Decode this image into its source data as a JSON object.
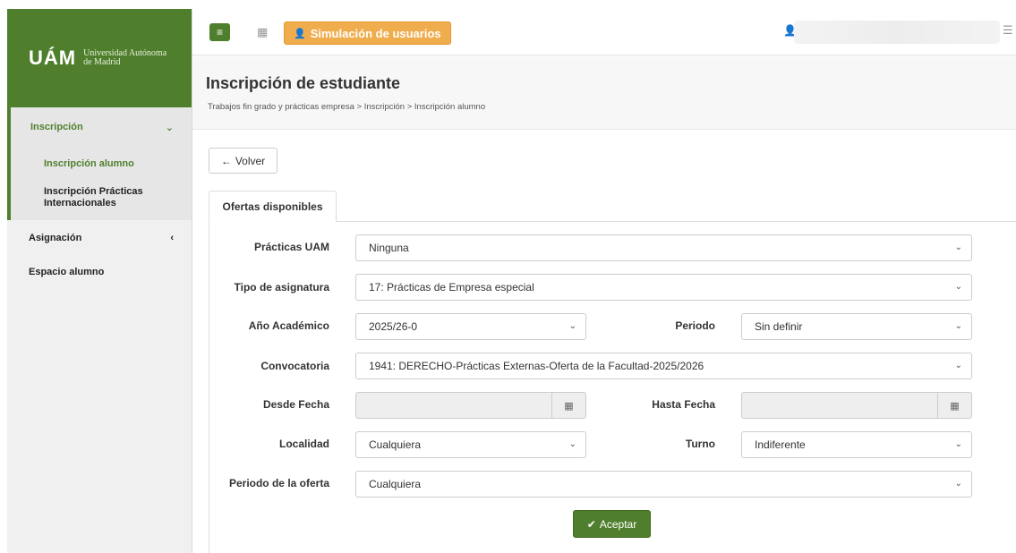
{
  "sidebar": {
    "logo_mark": "UÁM",
    "logo_line1": "Universidad Autónoma",
    "logo_line2": "de Madrid",
    "items": [
      {
        "label": "Inscripción",
        "chevron": "⌄"
      },
      {
        "label": "Inscripción alumno"
      },
      {
        "label": "Inscripción Prácticas Internacionales"
      },
      {
        "label": "Asignación",
        "chevron": "‹"
      },
      {
        "label": "Espacio alumno"
      }
    ]
  },
  "topbar": {
    "menu_icon": "≡",
    "grid_icon": "▦",
    "sim_icon": "👤",
    "sim_label": "Simulación de usuarios",
    "user_icon": "👤",
    "right_icon": "☰"
  },
  "header": {
    "title": "Inscripción de estudiante",
    "breadcrumb": "Trabajos fin grado y prácticas empresa > Inscripción > Inscripción alumno"
  },
  "back_button": {
    "icon": "←",
    "label": "Volver"
  },
  "tab": {
    "label": "Ofertas disponibles"
  },
  "form": {
    "practicas_uam": {
      "label": "Prácticas UAM",
      "value": "Ninguna"
    },
    "tipo_asignatura": {
      "label": "Tipo de asignatura",
      "value": "17: Prácticas de Empresa especial"
    },
    "anio_academico": {
      "label": "Año Académico",
      "value": "2025/26-0"
    },
    "periodo": {
      "label": "Periodo",
      "value": "Sin definir"
    },
    "convocatoria": {
      "label": "Convocatoria",
      "value": "1941: DERECHO-Prácticas Externas-Oferta de la Facultad-2025/2026"
    },
    "desde_fecha": {
      "label": "Desde Fecha",
      "value": ""
    },
    "hasta_fecha": {
      "label": "Hasta Fecha",
      "value": ""
    },
    "localidad": {
      "label": "Localidad",
      "value": "Cualquiera"
    },
    "turno": {
      "label": "Turno",
      "value": "Indiferente"
    },
    "periodo_oferta": {
      "label": "Periodo de la oferta",
      "value": "Cualquiera"
    },
    "select_arrow": "⌄",
    "calendar_icon": "▦"
  },
  "accept_button": {
    "icon": "✔",
    "label": "Aceptar"
  },
  "colors": {
    "brand_green": "#4f7f2d",
    "sim_orange": "#f0ad4e"
  }
}
